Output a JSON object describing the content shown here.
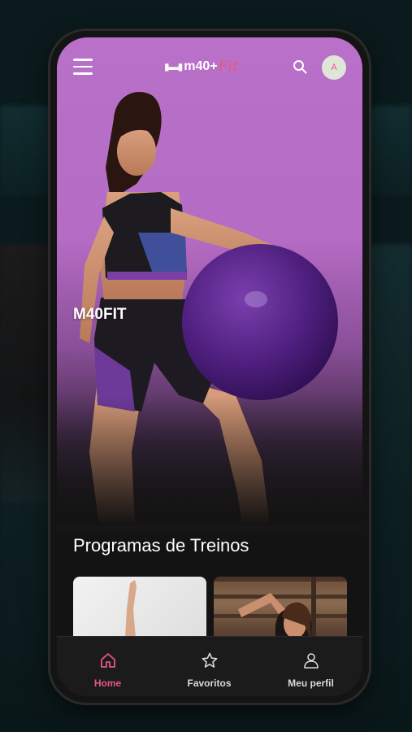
{
  "app": {
    "logo_main": "m40+",
    "logo_fit": "Fit.",
    "avatar_initial": "A"
  },
  "hero": {
    "title": "M40FIT"
  },
  "programs": {
    "section_title": "Programas de Treinos"
  },
  "bottom_nav": {
    "items": [
      {
        "label": "Home",
        "icon": "home-icon",
        "active": true
      },
      {
        "label": "Favoritos",
        "icon": "star-icon",
        "active": false
      },
      {
        "label": "Meu perfil",
        "icon": "user-icon",
        "active": false
      }
    ]
  },
  "colors": {
    "accent": "#e8557f",
    "hero_bg": "#b870c8",
    "nav_bg": "#1b1b1b"
  }
}
